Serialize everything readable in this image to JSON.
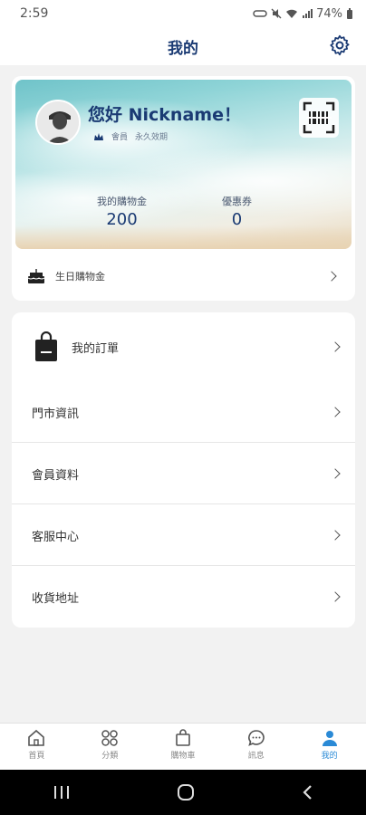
{
  "status": {
    "time": "2:59",
    "battery": "74%"
  },
  "header": {
    "title": "我的"
  },
  "profile": {
    "greeting": "您好 Nickname！",
    "tier": "會員",
    "validity": "永久效期"
  },
  "stats": [
    {
      "label": "我的購物金",
      "value": "200"
    },
    {
      "label": "優惠券",
      "value": "0"
    }
  ],
  "birthday": {
    "label": "生日購物金"
  },
  "menu": {
    "orders": "我的訂單",
    "stores": "門市資訊",
    "profile": "會員資料",
    "support": "客服中心",
    "address": "收貨地址"
  },
  "tabs": [
    {
      "label": "首頁",
      "icon": "home-icon"
    },
    {
      "label": "分類",
      "icon": "grid-icon"
    },
    {
      "label": "購物車",
      "icon": "bag-icon"
    },
    {
      "label": "訊息",
      "icon": "chat-icon"
    },
    {
      "label": "我的",
      "icon": "user-icon",
      "active": true
    }
  ],
  "colors": {
    "brand": "#1a3a73",
    "active_tab": "#2a8ad6"
  }
}
